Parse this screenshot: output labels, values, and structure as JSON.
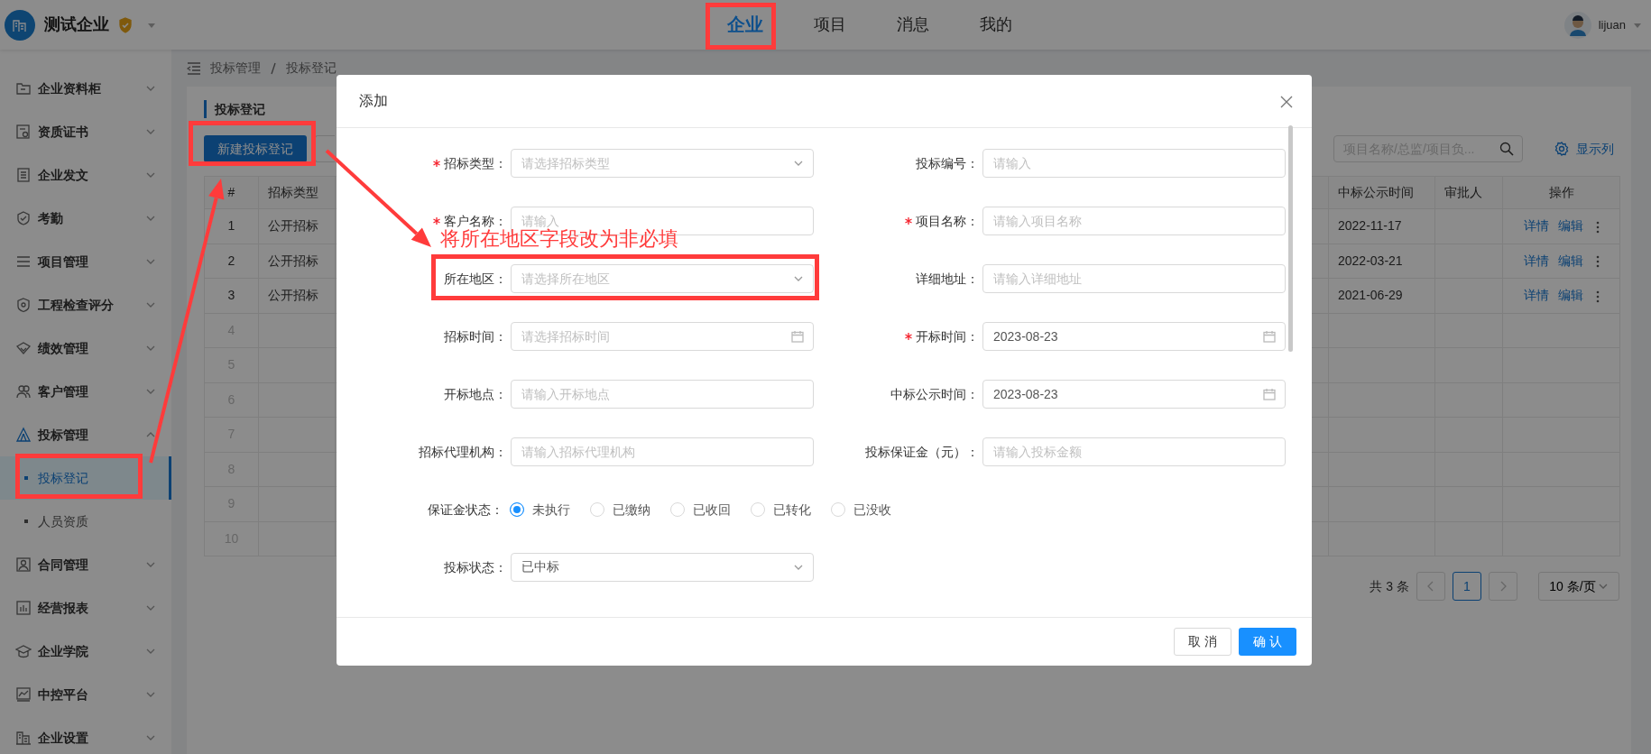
{
  "header": {
    "company": "测试企业",
    "nav": [
      {
        "label": "企业",
        "selected": true
      },
      {
        "label": "项目",
        "selected": false
      },
      {
        "label": "消息",
        "selected": false
      },
      {
        "label": "我的",
        "selected": false
      }
    ],
    "user": "lijuan"
  },
  "sidebar": {
    "items": [
      {
        "label": "企业资料柜",
        "expanded": false
      },
      {
        "label": "资质证书",
        "expanded": false
      },
      {
        "label": "企业发文",
        "expanded": false
      },
      {
        "label": "考勤",
        "expanded": false
      },
      {
        "label": "项目管理",
        "expanded": false
      },
      {
        "label": "工程检查评分",
        "expanded": false
      },
      {
        "label": "绩效管理",
        "expanded": false
      },
      {
        "label": "客户管理",
        "expanded": false
      },
      {
        "label": "投标管理",
        "expanded": true,
        "children": [
          {
            "label": "投标登记",
            "selected": true
          },
          {
            "label": "人员资质",
            "selected": false
          }
        ]
      },
      {
        "label": "合同管理",
        "expanded": false
      },
      {
        "label": "经营报表",
        "expanded": false
      },
      {
        "label": "企业学院",
        "expanded": false
      },
      {
        "label": "中控平台",
        "expanded": false
      },
      {
        "label": "企业设置",
        "expanded": false
      }
    ]
  },
  "breadcrumb": [
    "投标管理",
    "投标登记"
  ],
  "panel": {
    "title": "投标登记",
    "new_button": "新建投标登记",
    "search": {
      "placeholder": "项目名称/总监/项目负..."
    },
    "columns_button": "显示列"
  },
  "table": {
    "columns": [
      "#",
      "招标类型",
      "中标公示时间",
      "审批人",
      "操作"
    ],
    "rows": [
      {
        "no": "1",
        "type": "公开招标",
        "date": "2022-11-17",
        "actions": [
          "详情",
          "编辑"
        ]
      },
      {
        "no": "2",
        "type": "公开招标",
        "date": "2022-03-21",
        "actions": [
          "详情",
          "编辑"
        ]
      },
      {
        "no": "3",
        "type": "公开招标",
        "date": "2021-06-29",
        "actions": [
          "详情",
          "编辑"
        ]
      },
      {
        "no": "4"
      },
      {
        "no": "5"
      },
      {
        "no": "6"
      },
      {
        "no": "7"
      },
      {
        "no": "8"
      },
      {
        "no": "9"
      },
      {
        "no": "10"
      }
    ]
  },
  "pagination": {
    "total": "共 3 条",
    "pages": [
      {
        "label": "1",
        "selected": true
      }
    ],
    "page_size": "10 条/页"
  },
  "dialog": {
    "title": "添加",
    "fields": [
      {
        "label": "招标类型：",
        "required": true,
        "kind": "select",
        "placeholder": "请选择招标类型"
      },
      {
        "label": "投标编号：",
        "required": false,
        "kind": "text",
        "placeholder": "请输入"
      },
      {
        "label": "客户名称：",
        "required": true,
        "kind": "text",
        "placeholder": "请输入"
      },
      {
        "label": "项目名称：",
        "required": true,
        "kind": "text",
        "placeholder": "请输入项目名称"
      },
      {
        "label": "所在地区：",
        "required": false,
        "kind": "select",
        "placeholder": "请选择所在地区"
      },
      {
        "label": "详细地址：",
        "required": false,
        "kind": "text",
        "placeholder": "请输入详细地址"
      },
      {
        "label": "招标时间：",
        "required": false,
        "kind": "date",
        "placeholder": "请选择招标时间"
      },
      {
        "label": "开标时间：",
        "required": true,
        "kind": "date",
        "value": "2023-08-23"
      },
      {
        "label": "开标地点：",
        "required": false,
        "kind": "text",
        "placeholder": "请输入开标地点"
      },
      {
        "label": "中标公示时间：",
        "required": false,
        "kind": "date",
        "value": "2023-08-23"
      },
      {
        "label": "招标代理机构：",
        "required": false,
        "kind": "text",
        "placeholder": "请输入招标代理机构"
      },
      {
        "label": "投标保证金（元）：",
        "required": false,
        "kind": "text",
        "placeholder": "请输入投标金额"
      },
      {
        "label": "保证金状态：",
        "required": false,
        "kind": "radio",
        "options": [
          {
            "label": "未执行",
            "selected": true
          },
          {
            "label": "已缴纳",
            "selected": false
          },
          {
            "label": "已收回",
            "selected": false
          },
          {
            "label": "已转化",
            "selected": false
          },
          {
            "label": "已没收",
            "selected": false
          }
        ]
      },
      {
        "label": "投标状态：",
        "required": false,
        "kind": "select",
        "value": "已中标"
      }
    ],
    "buttons": [
      {
        "label": "取 消",
        "kind": "default"
      },
      {
        "label": "确 认",
        "kind": "primary"
      }
    ]
  },
  "annotation": {
    "note": "将所在地区字段改为非必填"
  }
}
